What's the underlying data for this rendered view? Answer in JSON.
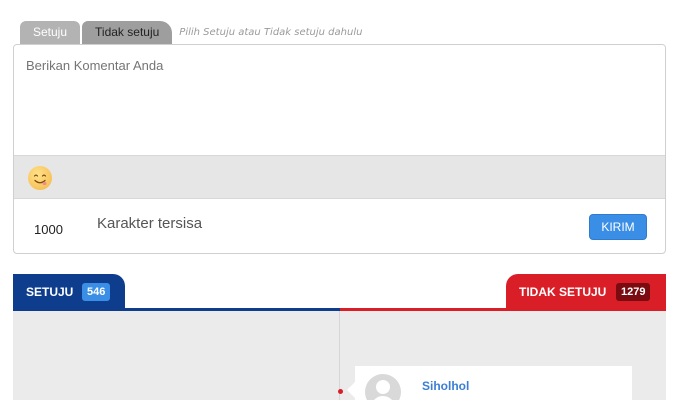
{
  "stance_tabs": {
    "agree": "Setuju",
    "disagree": "Tidak setuju",
    "hint": "Pilih Setuju atau Tidak setuju dahulu"
  },
  "comment_form": {
    "placeholder": "Berikan Komentar Anda",
    "emoji_icon": "smiling-face-icon",
    "char_count": "1000",
    "char_label": "Karakter tersisa",
    "submit_label": "KIRIM"
  },
  "vote_tabs": {
    "agree_label": "SETUJU",
    "agree_count": "546",
    "disagree_label": "TIDAK SETUJU",
    "disagree_count": "1279"
  },
  "colors": {
    "agree": "#0e3d8d",
    "disagree": "#da1e28",
    "accent": "#3a8ee6"
  },
  "comments": [
    {
      "username": "Siholhol",
      "side": "disagree"
    }
  ]
}
